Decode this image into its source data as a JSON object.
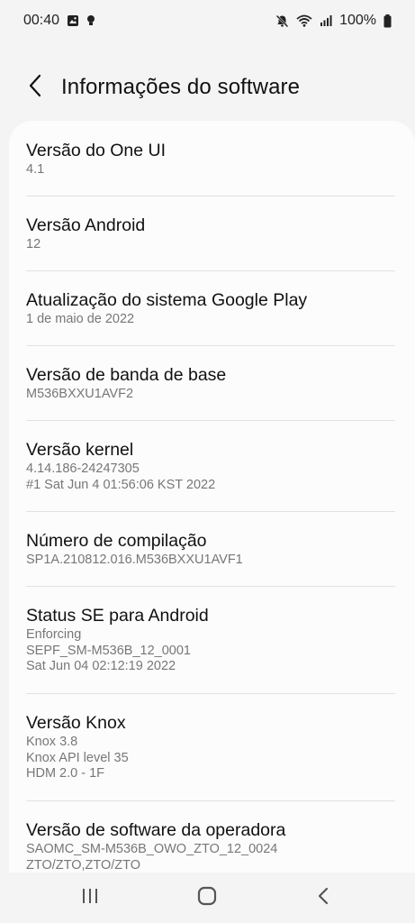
{
  "status_bar": {
    "time": "00:40",
    "battery_percent": "100%",
    "icons_left": [
      "gallery-icon",
      "bulb-icon"
    ],
    "icons_right": [
      "mute-icon",
      "wifi-icon",
      "signal-icon",
      "battery-icon"
    ]
  },
  "header": {
    "title": "Informações do software",
    "back_icon": "chevron-left-icon"
  },
  "items": [
    {
      "title": "Versão do One UI",
      "lines": [
        "4.1"
      ]
    },
    {
      "title": "Versão Android",
      "lines": [
        "12"
      ]
    },
    {
      "title": "Atualização do sistema Google Play",
      "lines": [
        "1 de maio de 2022"
      ]
    },
    {
      "title": "Versão de banda de base",
      "lines": [
        "M536BXXU1AVF2"
      ]
    },
    {
      "title": "Versão kernel",
      "lines": [
        "4.14.186-24247305",
        "#1 Sat Jun 4 01:56:06 KST 2022"
      ]
    },
    {
      "title": "Número de compilação",
      "lines": [
        "SP1A.210812.016.M536BXXU1AVF1"
      ]
    },
    {
      "title": "Status SE para Android",
      "lines": [
        "Enforcing",
        "SEPF_SM-M536B_12_0001",
        "Sat Jun 04 02:12:19 2022"
      ]
    },
    {
      "title": "Versão Knox",
      "lines": [
        "Knox 3.8",
        "Knox API level 35",
        "HDM 2.0 - 1F"
      ]
    },
    {
      "title": "Versão de software da operadora",
      "lines": [
        "SAOMC_SM-M536B_OWO_ZTO_12_0024",
        "ZTO/ZTO,ZTO/ZTO"
      ]
    }
  ],
  "nav_bar": {
    "recents_icon": "recents-icon",
    "home_icon": "home-icon",
    "back_icon": "back-icon"
  },
  "colors": {
    "background": "#f4f4f4",
    "card": "#fcfcfc",
    "title_text": "#111111",
    "subtitle_text": "#777777",
    "divider": "#e2e2e2"
  }
}
